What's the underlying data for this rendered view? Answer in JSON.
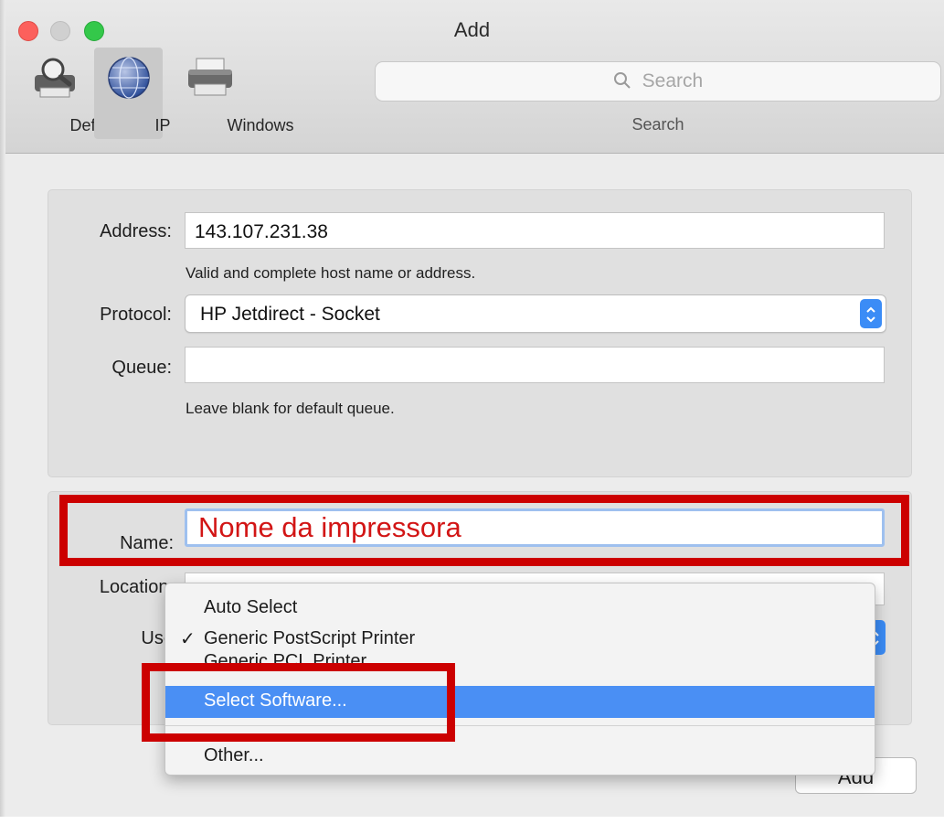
{
  "window": {
    "title": "Add"
  },
  "toolbar": {
    "items": [
      {
        "label": "Default",
        "icon": "printer-magnifier-icon"
      },
      {
        "label": "IP",
        "icon": "globe-icon",
        "selected": true
      },
      {
        "label": "Windows",
        "icon": "printer-icon"
      }
    ],
    "search": {
      "placeholder": "Search",
      "caption": "Search"
    }
  },
  "form": {
    "address": {
      "label": "Address:",
      "value": "143.107.231.38",
      "hint": "Valid and complete host name or address."
    },
    "protocol": {
      "label": "Protocol:",
      "value": "HP Jetdirect - Socket"
    },
    "queue": {
      "label": "Queue:",
      "value": "",
      "hint": "Leave blank for default queue."
    },
    "name": {
      "label": "Name:",
      "value": "Nome da impressora"
    },
    "location": {
      "label": "Location:"
    },
    "use": {
      "label": "Use"
    }
  },
  "menu": {
    "items": [
      {
        "label": "Auto Select"
      },
      {
        "label": "Generic PostScript Printer",
        "checked": true,
        "check": "✓"
      },
      {
        "label": "Generic PCL Printer"
      },
      {
        "label": "Select Software...",
        "highlighted": true
      },
      {
        "label": "Other..."
      }
    ]
  },
  "buttons": {
    "add": "Add"
  },
  "colors": {
    "annotation_red": "#cc0000",
    "menu_highlight": "#4a8ff4",
    "name_text": "#d21515"
  }
}
